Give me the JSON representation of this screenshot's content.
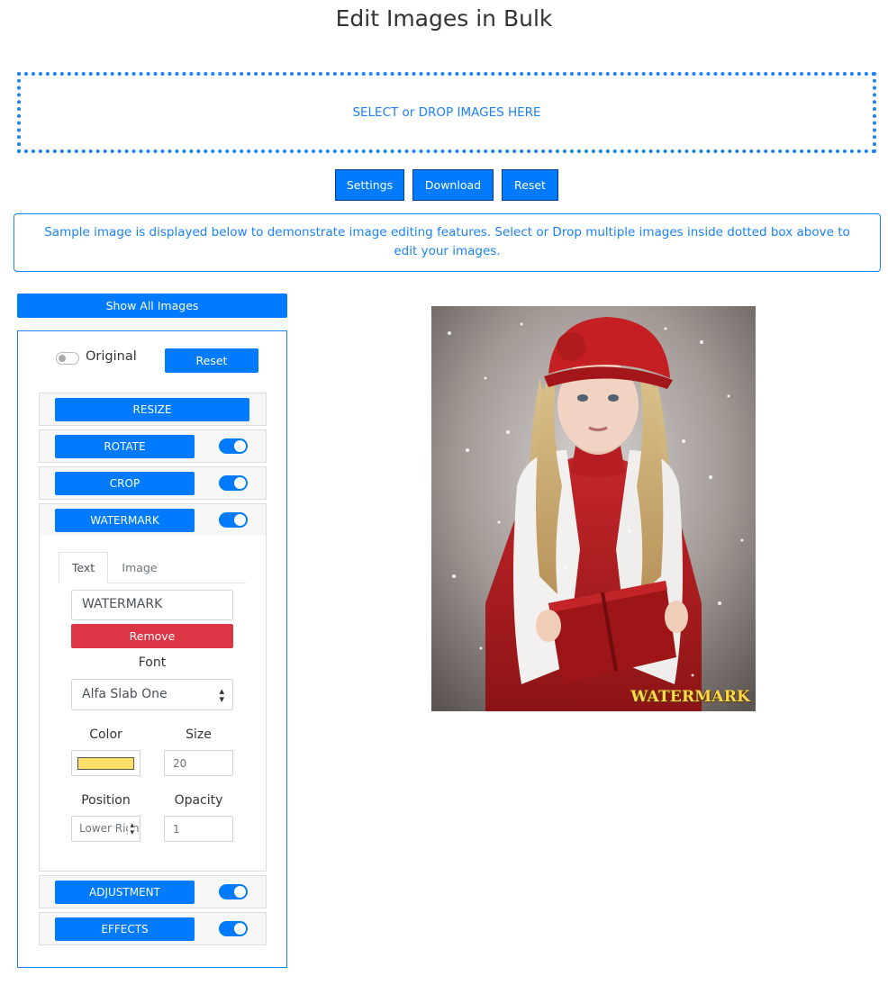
{
  "page": {
    "title": "Edit Images in Bulk"
  },
  "drop_zone": {
    "label": "SELECT or DROP IMAGES HERE"
  },
  "toolbar": {
    "settings_label": "Settings",
    "download_label": "Download",
    "reset_label": "Reset"
  },
  "info": {
    "message": "Sample image is displayed below to demonstrate image editing features. Select or Drop multiple images inside dotted box above to edit your images."
  },
  "sidebar": {
    "show_all_label": "Show All Images",
    "original_label": "Original",
    "original_on": false,
    "reset_label": "Reset",
    "sections": {
      "resize": {
        "label": "RESIZE"
      },
      "rotate": {
        "label": "ROTATE",
        "enabled": true
      },
      "crop": {
        "label": "CROP",
        "enabled": true
      },
      "watermark": {
        "label": "WATERMARK",
        "enabled": true
      },
      "adjustment": {
        "label": "ADJUSTMENT",
        "enabled": true
      },
      "effects": {
        "label": "EFFECTS",
        "enabled": true
      }
    },
    "watermark": {
      "tabs": {
        "text": "Text",
        "image": "Image",
        "active": "Text"
      },
      "text_value": "WATERMARK",
      "remove_label": "Remove",
      "font_label": "Font",
      "font_value": "Alfa Slab One",
      "color_label": "Color",
      "color_value": "#ffe066",
      "size_label": "Size",
      "size_value": "20",
      "position_label": "Position",
      "position_value": "Lower Right",
      "opacity_label": "Opacity",
      "opacity_value": "1"
    }
  },
  "preview": {
    "watermark_text": "WATERMARK"
  },
  "colors": {
    "accent": "#007bff",
    "danger": "#dc3545",
    "border_accent": "#1a82f7"
  },
  "icons": {
    "select_arrows": "select-arrows-icon",
    "toggle": "toggle-switch-icon"
  }
}
